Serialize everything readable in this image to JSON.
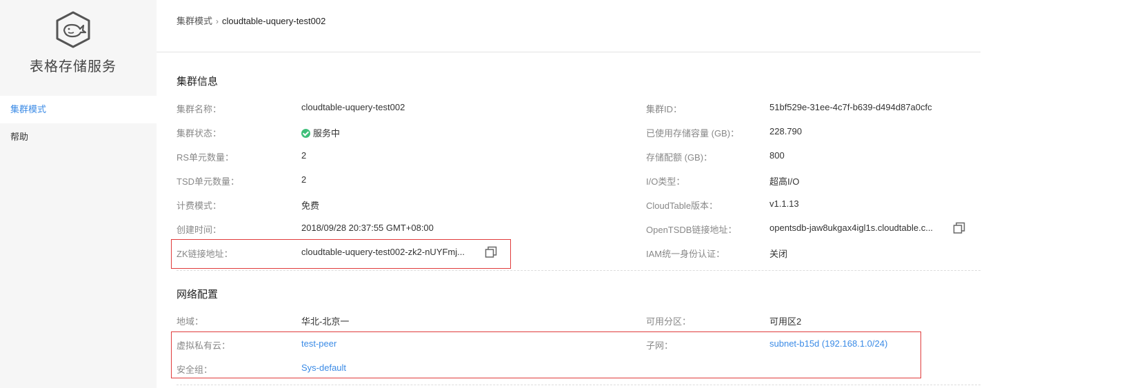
{
  "app": {
    "title": "表格存储服务"
  },
  "sidebar": {
    "items": [
      {
        "label": "集群模式"
      },
      {
        "label": "帮助"
      }
    ]
  },
  "breadcrumb": {
    "parent": "集群模式",
    "separator": "›",
    "current": "cloudtable-uquery-test002"
  },
  "cluster_info": {
    "title": "集群信息",
    "left": [
      {
        "label": "集群名称：",
        "value": "cloudtable-uquery-test002"
      },
      {
        "label": "集群状态：",
        "value": "服务中"
      },
      {
        "label": "RS单元数量：",
        "value": "2"
      },
      {
        "label": "TSD单元数量：",
        "value": "2"
      },
      {
        "label": "计费模式：",
        "value": "免费"
      },
      {
        "label": "创建时间：",
        "value": "2018/09/28 20:37:55 GMT+08:00"
      },
      {
        "label": "ZK链接地址：",
        "value": "cloudtable-uquery-test002-zk2-nUYFmj..."
      }
    ],
    "right": [
      {
        "label": "集群ID：",
        "value": "51bf529e-31ee-4c7f-b639-d494d87a0cfc"
      },
      {
        "label": "已使用存储容量 (GB)：",
        "value": "228.790"
      },
      {
        "label": "存储配额 (GB)：",
        "value": "800"
      },
      {
        "label": "I/O类型：",
        "value": "超高I/O"
      },
      {
        "label": "CloudTable版本：",
        "value": "v1.1.13"
      },
      {
        "label": "OpenTSDB链接地址：",
        "value": "opentsdb-jaw8ukgax4igl1s.cloudtable.c..."
      },
      {
        "label": "IAM统一身份认证：",
        "value": "关闭"
      }
    ]
  },
  "network": {
    "title": "网络配置",
    "region_label": "地域：",
    "region_value": "华北-北京一",
    "az_label": "可用分区：",
    "az_value": "可用区2",
    "vpc_label": "虚拟私有云：",
    "vpc_value": "test-peer",
    "subnet_label": "子网：",
    "subnet_value": "subnet-b15d (192.168.1.0/24)",
    "sg_label": "安全组：",
    "sg_value": "Sys-default"
  },
  "colors": {
    "accent": "#3b8be6",
    "highlight_box": "#e03a3a",
    "status_ok": "#3fbf7a"
  },
  "icons": {
    "logo": "whale-hexagon-icon",
    "copy": "copy-icon",
    "status": "check-circle-icon"
  }
}
